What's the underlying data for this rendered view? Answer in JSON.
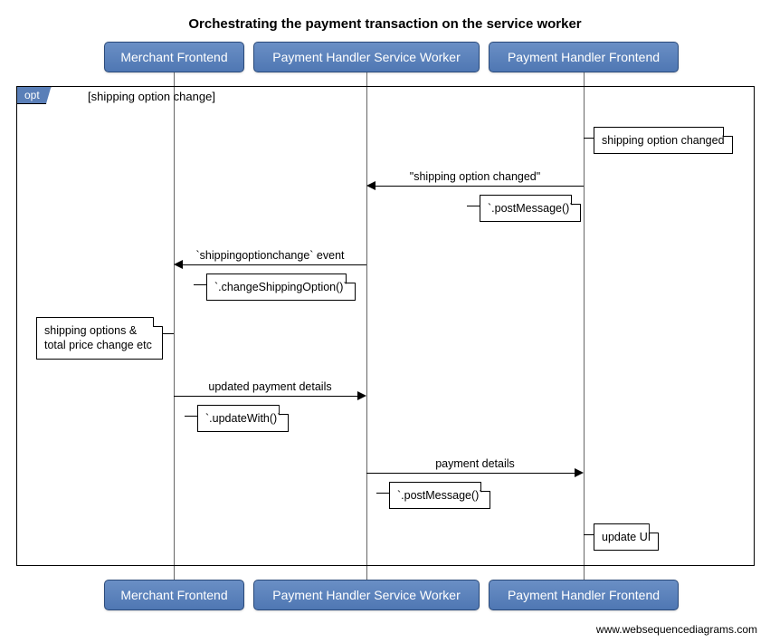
{
  "title": "Orchestrating the payment transaction on the service worker",
  "actors": {
    "merchant": "Merchant Frontend",
    "sw": "Payment Handler Service Worker",
    "frontend": "Payment Handler Frontend"
  },
  "frame": {
    "label": "opt",
    "guard": "[shipping option change]"
  },
  "notes": {
    "shipping_changed": "shipping option changed",
    "post_msg1": "`.postMessage()`",
    "change_shipping": "`.changeShippingOption()`",
    "options_total": "shipping options & total price change etc",
    "update_with": "`.updateWith()`",
    "post_msg2": "`.postMessage()`",
    "update_ui": "update UI"
  },
  "messages": {
    "m1": "\"shipping option changed\"",
    "m2": "`shippingoptionchange` event",
    "m3": "updated payment details",
    "m4": "payment details"
  },
  "credit": "www.websequencediagrams.com"
}
